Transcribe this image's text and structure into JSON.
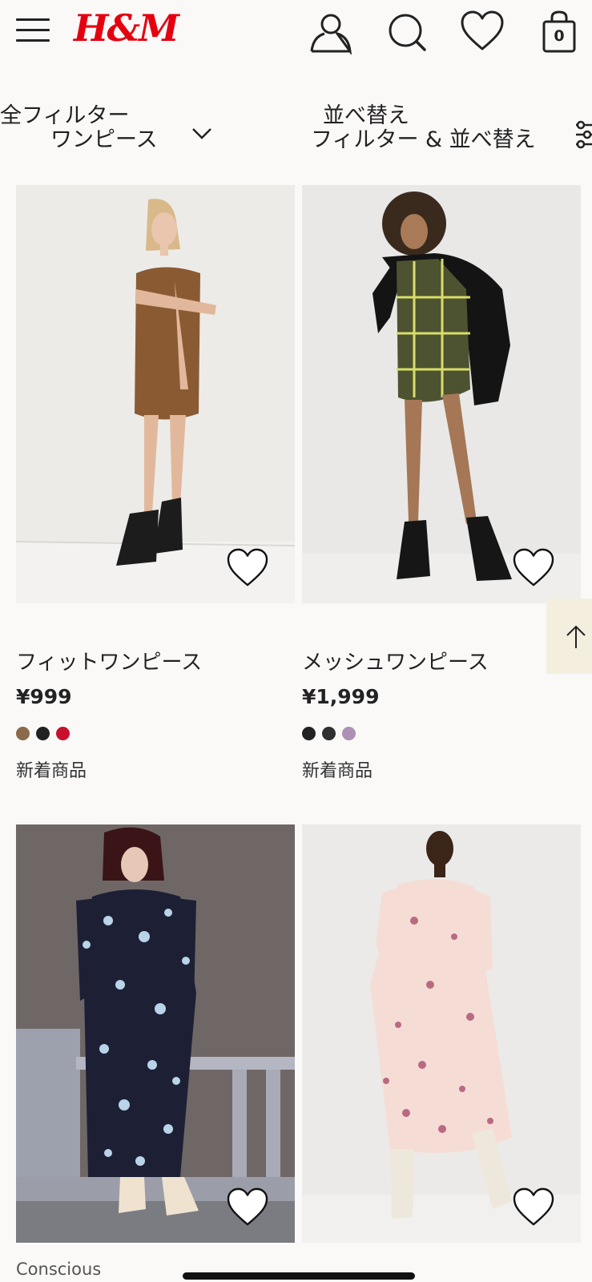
{
  "header": {
    "logo": "H&M",
    "bag_count": "0",
    "icons": [
      "menu-icon",
      "account-icon",
      "search-icon",
      "favourites-icon",
      "shopping-bag-icon"
    ]
  },
  "filters": {
    "all_filters_label": "全フィルター",
    "category_label": "ワンピース",
    "sort_label": "並べ替え",
    "filter_sort_label": "フィルター & 並べ替え"
  },
  "products": [
    {
      "name": "フィットワンピース",
      "price": "¥999",
      "colors": [
        "#8b6a4c",
        "#222222",
        "#c8102e"
      ],
      "badge": "新着商品"
    },
    {
      "name": "メッシュワンピース",
      "price": "¥1,999",
      "colors": [
        "#222222",
        "#2f2f2f",
        "#b08fb4"
      ],
      "badge": "新着商品"
    },
    {
      "badge": "Conscious"
    },
    {}
  ],
  "colors": {
    "brand_red": "#e50010",
    "background": "#faf9f8",
    "scroll_top_bg": "#f4eedf"
  }
}
